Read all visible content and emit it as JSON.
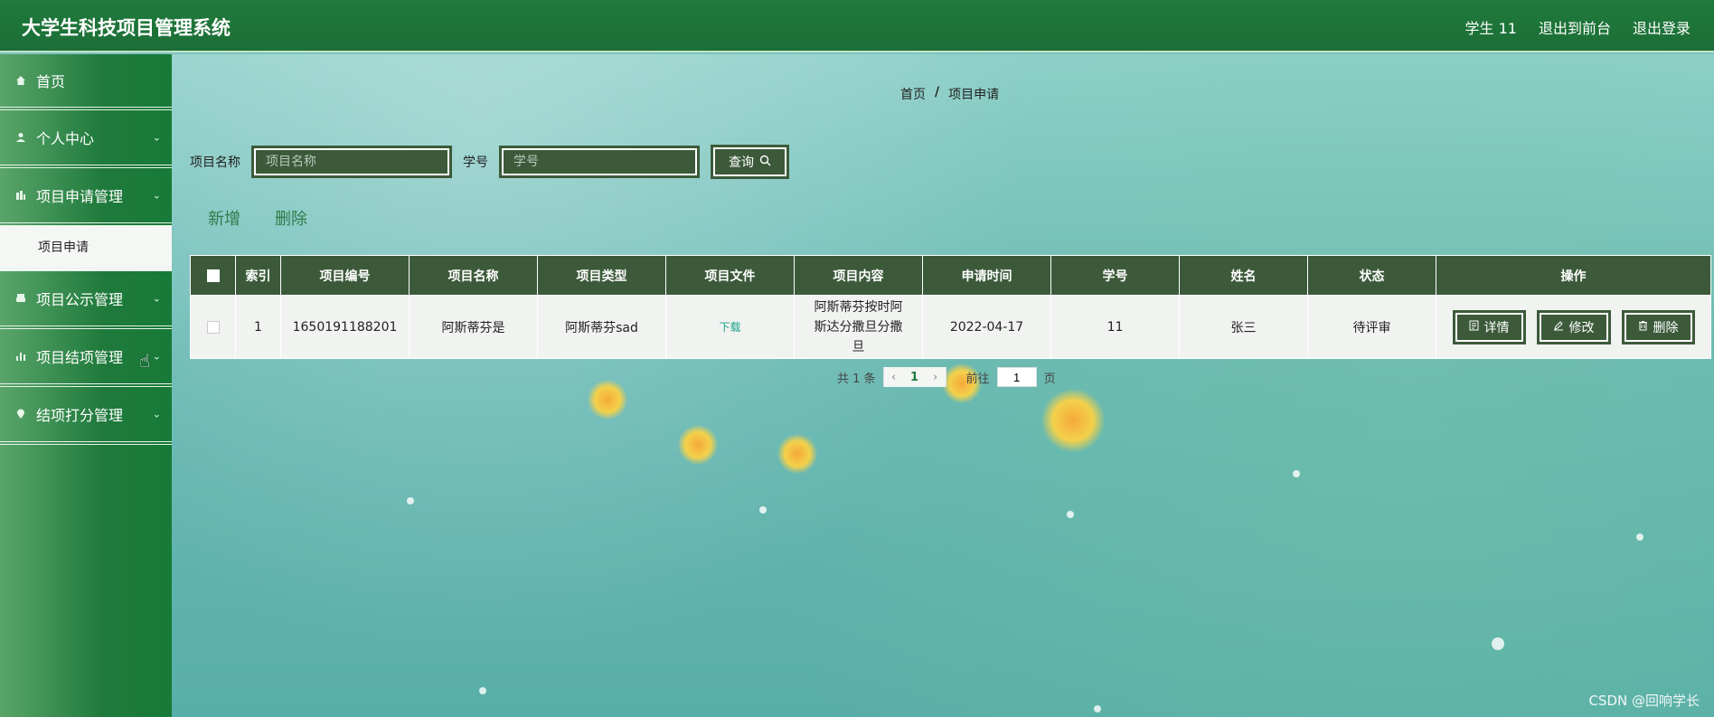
{
  "app": {
    "title": "大学生科技项目管理系统"
  },
  "header": {
    "user": "学生 11",
    "to_front": "退出到前台",
    "logout": "退出登录"
  },
  "sidebar": {
    "items": [
      {
        "label": "首页",
        "icon": "home-icon"
      },
      {
        "label": "个人中心",
        "icon": "user-icon"
      },
      {
        "label": "项目申请管理",
        "icon": "chart-icon"
      },
      {
        "label": "项目申请",
        "icon": ""
      },
      {
        "label": "项目公示管理",
        "icon": "printer-icon"
      },
      {
        "label": "项目结项管理",
        "icon": "bar-chart-icon"
      },
      {
        "label": "结项打分管理",
        "icon": "location-icon"
      }
    ]
  },
  "breadcrumb": {
    "home": "首页",
    "sep": "/",
    "current": "项目申请"
  },
  "search": {
    "name_label": "项目名称",
    "name_placeholder": "项目名称",
    "id_label": "学号",
    "id_placeholder": "学号",
    "query_label": "查询"
  },
  "actions": {
    "add": "新增",
    "delete": "删除"
  },
  "table": {
    "headers": [
      "索引",
      "项目编号",
      "项目名称",
      "项目类型",
      "项目文件",
      "项目内容",
      "申请时间",
      "学号",
      "姓名",
      "状态",
      "操作"
    ],
    "rows": [
      {
        "index": "1",
        "code": "1650191188201",
        "name": "阿斯蒂芬是",
        "type": "阿斯蒂芬sad",
        "file": "下载",
        "content": "阿斯蒂芬按时阿斯达分撒旦分撒旦",
        "date": "2022-04-17",
        "student_id": "11",
        "student_name": "张三",
        "status": "待评审",
        "op_detail": "详情",
        "op_edit": "修改",
        "op_delete": "删除"
      }
    ]
  },
  "pager": {
    "total": "共 1 条",
    "page": "1",
    "goto": "前往",
    "goto_value": "1",
    "unit": "页"
  },
  "watermark": "CSDN @回响学长"
}
